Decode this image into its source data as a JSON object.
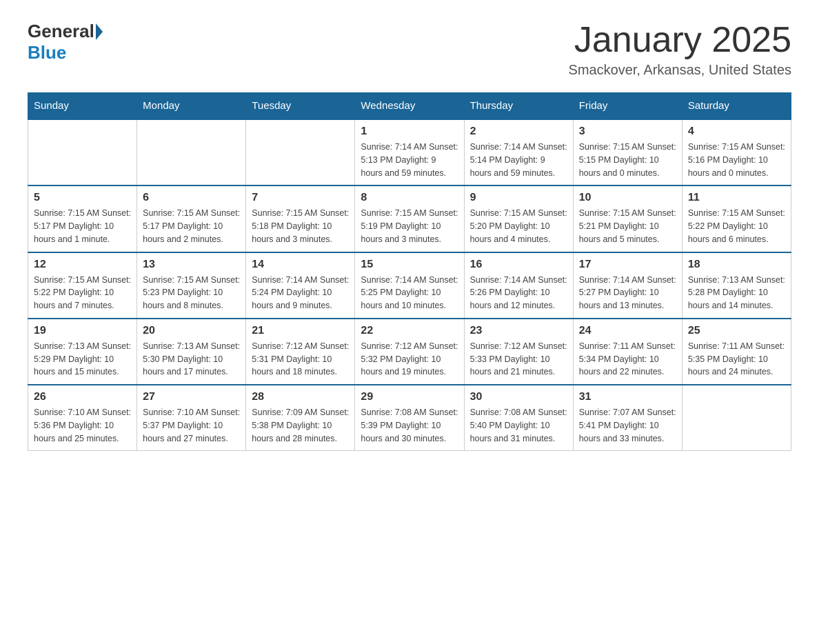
{
  "logo": {
    "general": "General",
    "blue": "Blue"
  },
  "title": "January 2025",
  "subtitle": "Smackover, Arkansas, United States",
  "days_of_week": [
    "Sunday",
    "Monday",
    "Tuesday",
    "Wednesday",
    "Thursday",
    "Friday",
    "Saturday"
  ],
  "weeks": [
    [
      {
        "day": "",
        "info": ""
      },
      {
        "day": "",
        "info": ""
      },
      {
        "day": "",
        "info": ""
      },
      {
        "day": "1",
        "info": "Sunrise: 7:14 AM\nSunset: 5:13 PM\nDaylight: 9 hours and 59 minutes."
      },
      {
        "day": "2",
        "info": "Sunrise: 7:14 AM\nSunset: 5:14 PM\nDaylight: 9 hours and 59 minutes."
      },
      {
        "day": "3",
        "info": "Sunrise: 7:15 AM\nSunset: 5:15 PM\nDaylight: 10 hours and 0 minutes."
      },
      {
        "day": "4",
        "info": "Sunrise: 7:15 AM\nSunset: 5:16 PM\nDaylight: 10 hours and 0 minutes."
      }
    ],
    [
      {
        "day": "5",
        "info": "Sunrise: 7:15 AM\nSunset: 5:17 PM\nDaylight: 10 hours and 1 minute."
      },
      {
        "day": "6",
        "info": "Sunrise: 7:15 AM\nSunset: 5:17 PM\nDaylight: 10 hours and 2 minutes."
      },
      {
        "day": "7",
        "info": "Sunrise: 7:15 AM\nSunset: 5:18 PM\nDaylight: 10 hours and 3 minutes."
      },
      {
        "day": "8",
        "info": "Sunrise: 7:15 AM\nSunset: 5:19 PM\nDaylight: 10 hours and 3 minutes."
      },
      {
        "day": "9",
        "info": "Sunrise: 7:15 AM\nSunset: 5:20 PM\nDaylight: 10 hours and 4 minutes."
      },
      {
        "day": "10",
        "info": "Sunrise: 7:15 AM\nSunset: 5:21 PM\nDaylight: 10 hours and 5 minutes."
      },
      {
        "day": "11",
        "info": "Sunrise: 7:15 AM\nSunset: 5:22 PM\nDaylight: 10 hours and 6 minutes."
      }
    ],
    [
      {
        "day": "12",
        "info": "Sunrise: 7:15 AM\nSunset: 5:22 PM\nDaylight: 10 hours and 7 minutes."
      },
      {
        "day": "13",
        "info": "Sunrise: 7:15 AM\nSunset: 5:23 PM\nDaylight: 10 hours and 8 minutes."
      },
      {
        "day": "14",
        "info": "Sunrise: 7:14 AM\nSunset: 5:24 PM\nDaylight: 10 hours and 9 minutes."
      },
      {
        "day": "15",
        "info": "Sunrise: 7:14 AM\nSunset: 5:25 PM\nDaylight: 10 hours and 10 minutes."
      },
      {
        "day": "16",
        "info": "Sunrise: 7:14 AM\nSunset: 5:26 PM\nDaylight: 10 hours and 12 minutes."
      },
      {
        "day": "17",
        "info": "Sunrise: 7:14 AM\nSunset: 5:27 PM\nDaylight: 10 hours and 13 minutes."
      },
      {
        "day": "18",
        "info": "Sunrise: 7:13 AM\nSunset: 5:28 PM\nDaylight: 10 hours and 14 minutes."
      }
    ],
    [
      {
        "day": "19",
        "info": "Sunrise: 7:13 AM\nSunset: 5:29 PM\nDaylight: 10 hours and 15 minutes."
      },
      {
        "day": "20",
        "info": "Sunrise: 7:13 AM\nSunset: 5:30 PM\nDaylight: 10 hours and 17 minutes."
      },
      {
        "day": "21",
        "info": "Sunrise: 7:12 AM\nSunset: 5:31 PM\nDaylight: 10 hours and 18 minutes."
      },
      {
        "day": "22",
        "info": "Sunrise: 7:12 AM\nSunset: 5:32 PM\nDaylight: 10 hours and 19 minutes."
      },
      {
        "day": "23",
        "info": "Sunrise: 7:12 AM\nSunset: 5:33 PM\nDaylight: 10 hours and 21 minutes."
      },
      {
        "day": "24",
        "info": "Sunrise: 7:11 AM\nSunset: 5:34 PM\nDaylight: 10 hours and 22 minutes."
      },
      {
        "day": "25",
        "info": "Sunrise: 7:11 AM\nSunset: 5:35 PM\nDaylight: 10 hours and 24 minutes."
      }
    ],
    [
      {
        "day": "26",
        "info": "Sunrise: 7:10 AM\nSunset: 5:36 PM\nDaylight: 10 hours and 25 minutes."
      },
      {
        "day": "27",
        "info": "Sunrise: 7:10 AM\nSunset: 5:37 PM\nDaylight: 10 hours and 27 minutes."
      },
      {
        "day": "28",
        "info": "Sunrise: 7:09 AM\nSunset: 5:38 PM\nDaylight: 10 hours and 28 minutes."
      },
      {
        "day": "29",
        "info": "Sunrise: 7:08 AM\nSunset: 5:39 PM\nDaylight: 10 hours and 30 minutes."
      },
      {
        "day": "30",
        "info": "Sunrise: 7:08 AM\nSunset: 5:40 PM\nDaylight: 10 hours and 31 minutes."
      },
      {
        "day": "31",
        "info": "Sunrise: 7:07 AM\nSunset: 5:41 PM\nDaylight: 10 hours and 33 minutes."
      },
      {
        "day": "",
        "info": ""
      }
    ]
  ]
}
